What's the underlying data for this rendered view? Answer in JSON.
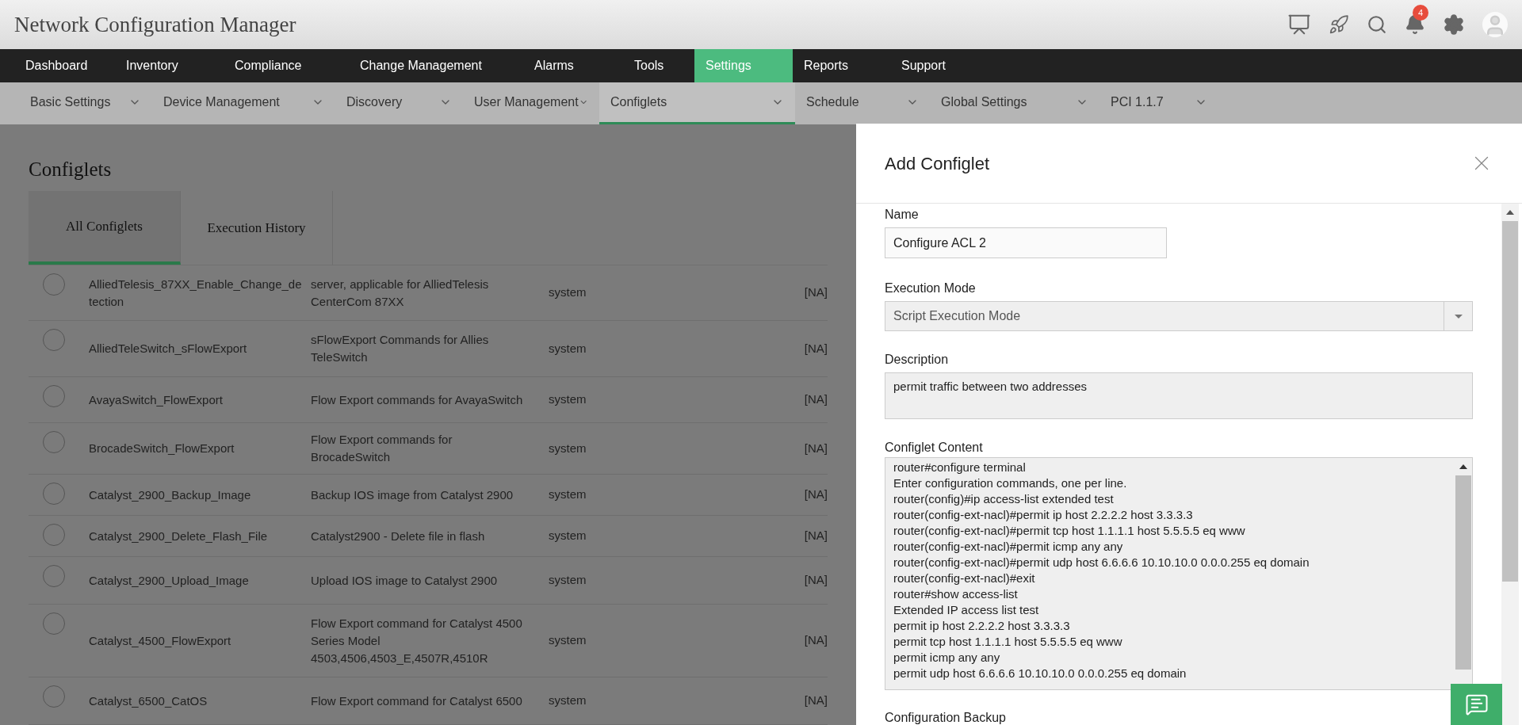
{
  "app": {
    "title": "Network Configuration Manager",
    "notification_count": "4"
  },
  "nav": [
    {
      "label": "Dashboard",
      "selected": false
    },
    {
      "label": "Inventory",
      "selected": false
    },
    {
      "label": "Compliance",
      "selected": false
    },
    {
      "label": "Change Management",
      "selected": false
    },
    {
      "label": "Alarms",
      "selected": false
    },
    {
      "label": "Tools",
      "selected": false
    },
    {
      "label": "Settings",
      "selected": true
    },
    {
      "label": "Reports",
      "selected": false
    },
    {
      "label": "Support",
      "selected": false
    }
  ],
  "subnav": [
    {
      "label": "Basic Settings",
      "selected": false
    },
    {
      "label": "Device Management",
      "selected": false
    },
    {
      "label": "Discovery",
      "selected": false
    },
    {
      "label": "User Management",
      "selected": false
    },
    {
      "label": "Configlets",
      "selected": true
    },
    {
      "label": "Schedule",
      "selected": false
    },
    {
      "label": "Global Settings",
      "selected": false
    },
    {
      "label": "PCI 1.1.7",
      "selected": false
    }
  ],
  "page": {
    "title": "Configlets",
    "tabs": [
      {
        "label": "All Configlets",
        "selected": true
      },
      {
        "label": "Execution History",
        "selected": false
      }
    ],
    "rows": [
      {
        "selected": false,
        "name": "AlliedTelesis_87XX_Enable_Change_detection",
        "description": "server, applicable for AlliedTelesis CenterCom 87XX",
        "owner": "system",
        "column_4": "[NA]"
      },
      {
        "selected": false,
        "name": "AlliedTeleSwitch_sFlowExport",
        "description": "sFlowExport Commands for Allies TeleSwitch",
        "owner": "system",
        "column_4": "[NA]"
      },
      {
        "selected": false,
        "name": "AvayaSwitch_FlowExport",
        "description": "Flow Export commands for AvayaSwitch",
        "owner": "system",
        "column_4": "[NA]"
      },
      {
        "selected": false,
        "name": "BrocadeSwitch_FlowExport",
        "description": "Flow Export commands for BrocadeSwitch",
        "owner": "system",
        "column_4": "[NA]"
      },
      {
        "selected": false,
        "name": "Catalyst_2900_Backup_Image",
        "description": "Backup IOS image from Catalyst 2900",
        "owner": "system",
        "column_4": "[NA]"
      },
      {
        "selected": false,
        "name": "Catalyst_2900_Delete_Flash_File",
        "description": "Catalyst2900 - Delete file in flash",
        "owner": "system",
        "column_4": "[NA]"
      },
      {
        "selected": false,
        "name": "Catalyst_2900_Upload_Image",
        "description": "Upload IOS image to Catalyst 2900",
        "owner": "system",
        "column_4": "[NA]"
      },
      {
        "selected": false,
        "name": "Catalyst_4500_FlowExport",
        "description": "Flow Export command for Catalyst 4500 Series Model 4503,4506,4503_E,4507R,4510R",
        "owner": "system",
        "column_4": "[NA]"
      },
      {
        "selected": false,
        "name": "Catalyst_6500_CatOS",
        "description": "Flow Export command for Catalyst 6500",
        "owner": "system",
        "column_4": "[NA]"
      }
    ]
  },
  "panel": {
    "title": "Add Configlet",
    "name_label": "Name",
    "name_value": "Configure ACL 2",
    "mode_label": "Execution Mode",
    "mode_value": "Script Execution Mode",
    "description_label": "Description",
    "description_value": "permit traffic between two addresses",
    "content_label": "Configlet Content",
    "content_lines": [
      "router#configure terminal",
      "Enter configuration commands, one per line.",
      "router(config)#ip access-list extended test",
      "router(config-ext-nacl)#permit ip host 2.2.2.2 host 3.3.3.3",
      "router(config-ext-nacl)#permit tcp host 1.1.1.1 host 5.5.5.5 eq www",
      "router(config-ext-nacl)#permit icmp any any",
      "router(config-ext-nacl)#permit udp host 6.6.6.6 10.10.10.0 0.0.0.255 eq domain",
      "router(config-ext-nacl)#exit",
      "router#show access-list",
      "Extended IP access list test",
      "permit ip host 2.2.2.2 host 3.3.3.3",
      "permit tcp host 1.1.1.1 host 5.5.5.5 eq www",
      "permit icmp any any",
      "permit udp host 6.6.6.6 10.10.10.0 0.0.0.255 eq domain"
    ],
    "backup_label": "Configuration Backup"
  }
}
